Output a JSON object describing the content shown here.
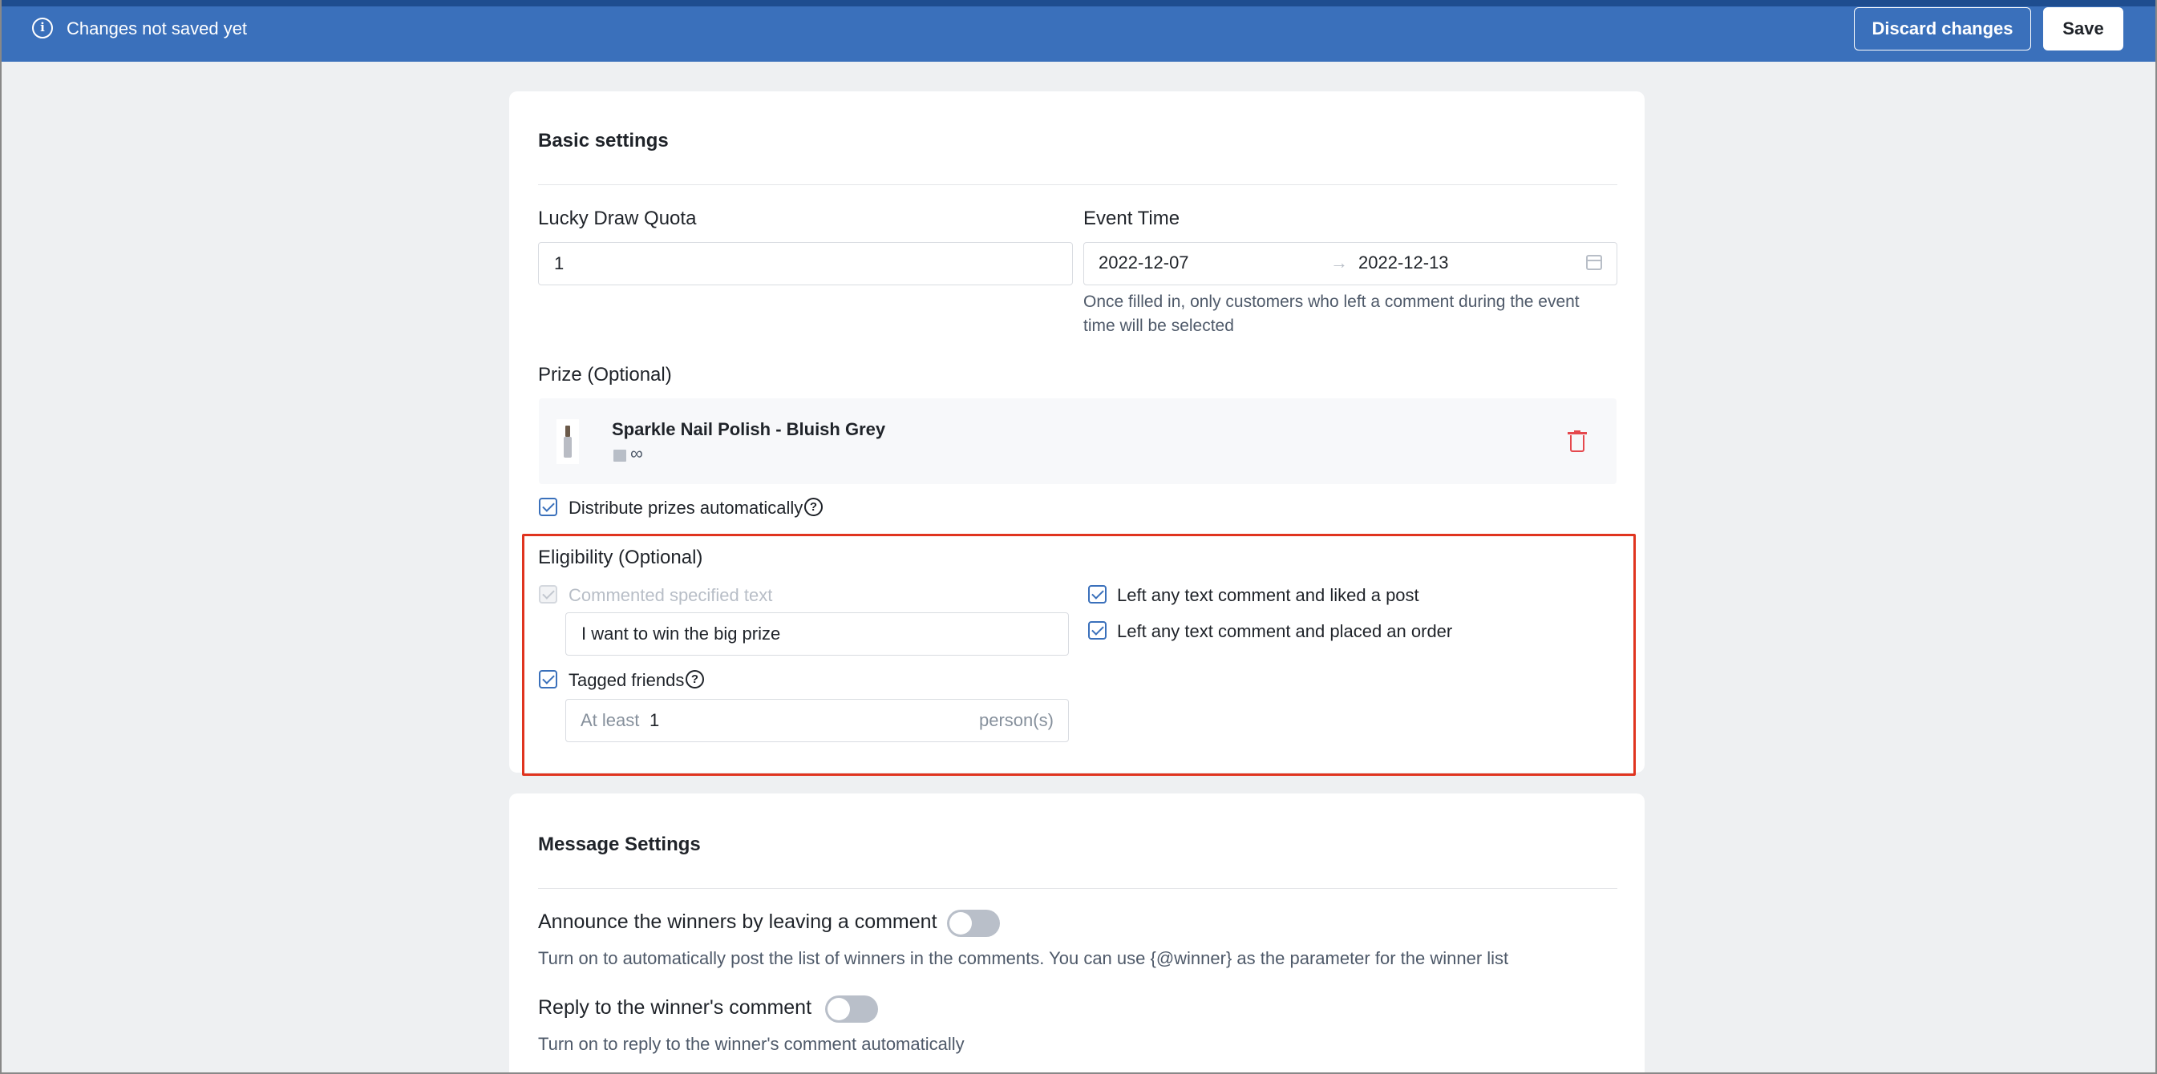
{
  "topbar": {
    "message": "Changes not saved yet",
    "info_icon": "info-icon",
    "discard_label": "Discard changes",
    "save_label": "Save"
  },
  "basic": {
    "title": "Basic settings",
    "quota_label": "Lucky Draw Quota",
    "quota_value": "1",
    "event_label": "Event Time",
    "event_start": "2022-12-07",
    "event_arrow": "→",
    "event_end": "2022-12-13",
    "event_hint_line1": "Once filled in, only customers who left a comment during the event",
    "event_hint_line2": "time will be selected",
    "prize_label": "Prize (Optional)",
    "prize_name": "Sparkle Nail Polish - Bluish Grey",
    "prize_stock": "∞",
    "distribute_label": "Distribute prizes automatically",
    "distribute_checked": true
  },
  "eligibility": {
    "title": "Eligibility (Optional)",
    "commented_label": "Commented specified text",
    "commented_text": "I want to win the big prize",
    "tagged_label": "Tagged friends",
    "tagged_prefix": "At least",
    "tagged_value": "1",
    "tagged_suffix": "person(s)",
    "liked_label": "Left any text comment and liked a post",
    "ordered_label": "Left any text comment and placed an order"
  },
  "message": {
    "title": "Message Settings",
    "announce_label": "Announce the winners by leaving a comment",
    "announce_hint": "Turn on to automatically post the list of winners in the comments. You can use {@winner} as the parameter for the winner list",
    "announce_on": false,
    "reply_label": "Reply to the winner's comment",
    "reply_hint": "Turn on to reply to the winner's comment automatically",
    "reply_on": false
  },
  "colors": {
    "topbar": "#3a70bb",
    "accent": "#3a70bb",
    "danger": "#e5484d",
    "highlight": "#e0341f"
  }
}
